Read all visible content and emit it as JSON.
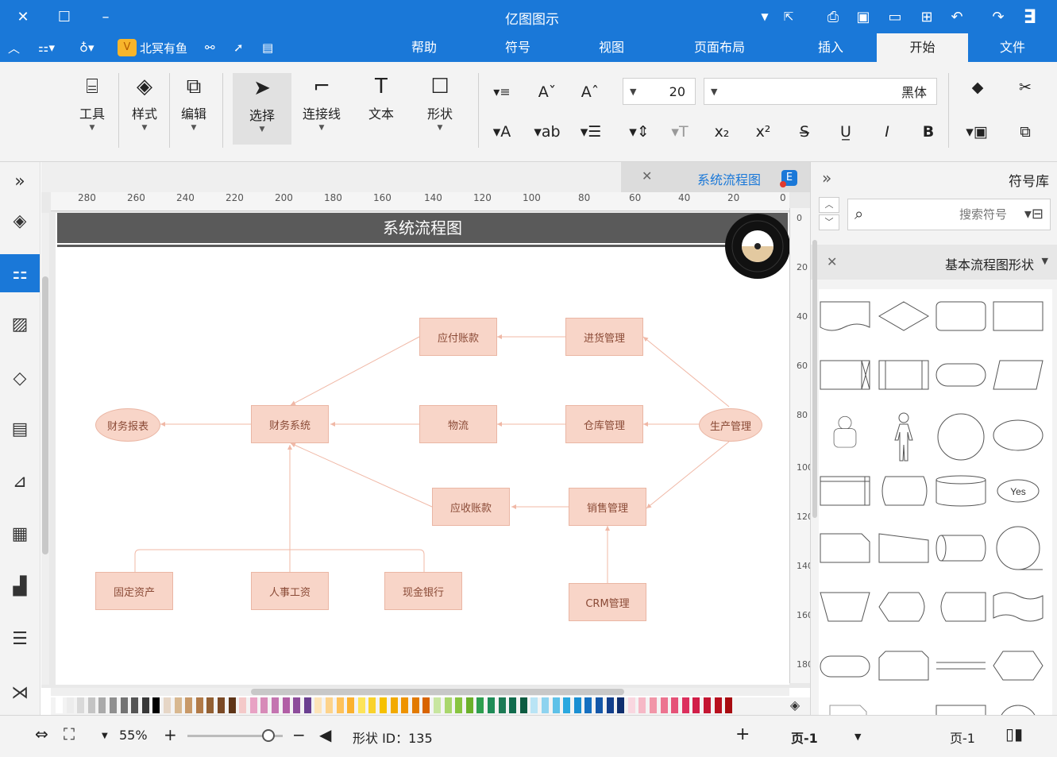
{
  "app": {
    "title": "亿图图示",
    "vip_label": "北冥有鱼",
    "tabs": [
      "文件",
      "开始",
      "插入",
      "页面布局",
      "视图",
      "符号",
      "帮助"
    ],
    "active_tab": "开始"
  },
  "ribbon": {
    "font_name": "黑体",
    "font_size": "20",
    "buttons": [
      {
        "label": "工具"
      },
      {
        "label": "样式"
      },
      {
        "label": "编辑"
      },
      {
        "label": "选择"
      },
      {
        "label": "连接线"
      },
      {
        "label": "文本"
      },
      {
        "label": "形状"
      }
    ]
  },
  "document": {
    "tab_name": "系统流程图",
    "page_title": "系统流程图"
  },
  "ruler": {
    "h_labels": [
      "280",
      "260",
      "240",
      "220",
      "200",
      "180",
      "160",
      "140",
      "120",
      "100",
      "80",
      "60",
      "40",
      "20",
      "0"
    ],
    "v_labels": [
      "0",
      "20",
      "40",
      "60",
      "80",
      "100",
      "120",
      "140",
      "160",
      "180"
    ]
  },
  "diagram": {
    "nodes": [
      {
        "id": "payable",
        "label": "应付账款"
      },
      {
        "id": "purchase",
        "label": "进货管理"
      },
      {
        "id": "finance_report",
        "label": "财务报表"
      },
      {
        "id": "finance_sys",
        "label": "财务系统"
      },
      {
        "id": "logistics",
        "label": "物流"
      },
      {
        "id": "warehouse",
        "label": "仓库管理"
      },
      {
        "id": "production",
        "label": "生产管理"
      },
      {
        "id": "receivable",
        "label": "应收账款"
      },
      {
        "id": "sales",
        "label": "销售管理"
      },
      {
        "id": "fixed_assets",
        "label": "固定资产"
      },
      {
        "id": "hr_salary",
        "label": "人事工资"
      },
      {
        "id": "cash_bank",
        "label": "现金银行"
      },
      {
        "id": "crm",
        "label": "CRM管理"
      }
    ]
  },
  "right_panel": {
    "title": "符号库",
    "search_placeholder": "搜索符号",
    "category": "基本流程图形状",
    "shape_yes_label": "Yes"
  },
  "status": {
    "page_label": "页-1",
    "page_tab": "页-1",
    "shape_id": "形状 ID：135",
    "zoom": "55%"
  },
  "colors": {
    "brand": "#1a78d8",
    "node_fill": "#f8d5c8",
    "node_border": "#eab6a4",
    "edge": "#f0b8a6",
    "header": "#5a5a5a"
  }
}
